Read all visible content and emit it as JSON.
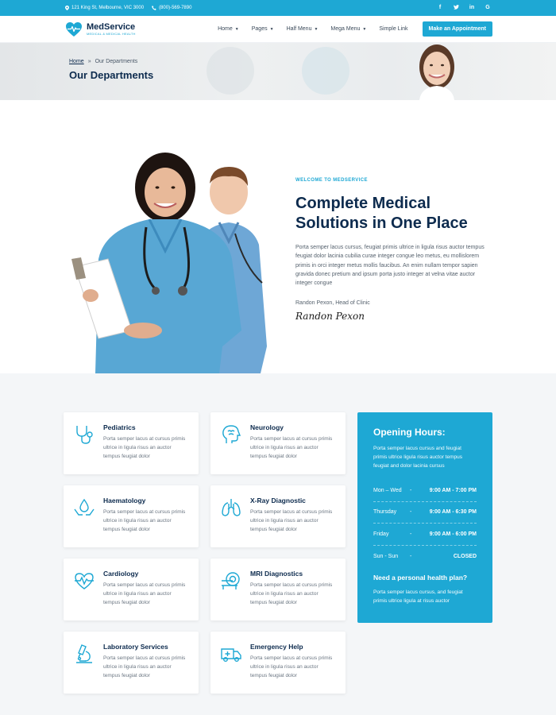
{
  "topbar": {
    "address": "121 King St, Melbourne, VIC 3000",
    "phone": "(800)-569-7890",
    "social": [
      "f",
      "t",
      "in",
      "G"
    ]
  },
  "brand": {
    "name": "MedService",
    "tagline": "MEDICAL & MEDICAL HEALTH"
  },
  "nav": {
    "items": [
      {
        "label": "Home",
        "has_dropdown": true
      },
      {
        "label": "Pages",
        "has_dropdown": true
      },
      {
        "label": "Half Menu",
        "has_dropdown": true
      },
      {
        "label": "Mega Menu",
        "has_dropdown": true
      },
      {
        "label": "Simple Link",
        "has_dropdown": false
      }
    ],
    "cta": "Make an Appointment"
  },
  "page_header": {
    "breadcrumb_home": "Home",
    "breadcrumb_sep": "»",
    "breadcrumb_current": "Our Departments",
    "title": "Our Departments"
  },
  "about": {
    "eyebrow": "WELCOME TO MEDSERVICE",
    "title": "Complete Medical Solutions in One Place",
    "body": "Porta semper lacus cursus, feugiat primis ultrice in ligula risus auctor tempus feugiat dolor lacinia cubilia curae integer congue leo metus, eu mollislorem primis in orci integer metus mollis faucibus. An enim nullam tempor sapien gravida donec pretium and ipsum porta justo integer at velna vitae auctor integer congue",
    "signer": "Randon Pexon, Head of Clinic",
    "signature": "Randon Pexon"
  },
  "departments": [
    {
      "name": "Pediatrics",
      "icon": "stethoscope-icon",
      "desc": "Porta semper lacus at cursus primis ultrice in ligula risus an auctor tempus feugiat dolor"
    },
    {
      "name": "Neurology",
      "icon": "head-brain-icon",
      "desc": "Porta semper lacus at cursus primis ultrice in ligula risus an auctor tempus feugiat dolor"
    },
    {
      "name": "Haematology",
      "icon": "blood-drop-hands-icon",
      "desc": "Porta semper lacus at cursus primis ultrice in ligula risus an auctor tempus feugiat dolor"
    },
    {
      "name": "X-Ray Diagnostic",
      "icon": "lungs-icon",
      "desc": "Porta semper lacus at cursus primis ultrice in ligula risus an auctor tempus feugiat dolor"
    },
    {
      "name": "Cardiology",
      "icon": "heart-pulse-icon",
      "desc": "Porta semper lacus at cursus primis ultrice in ligula risus an auctor tempus feugiat dolor"
    },
    {
      "name": "MRI Diagnostics",
      "icon": "mri-scanner-icon",
      "desc": "Porta semper lacus at cursus primis ultrice in ligula risus an auctor tempus feugiat dolor"
    },
    {
      "name": "Laboratory Services",
      "icon": "microscope-icon",
      "desc": "Porta semper lacus at cursus primis ultrice in ligula risus an auctor tempus feugiat dolor"
    },
    {
      "name": "Emergency Help",
      "icon": "ambulance-icon",
      "desc": "Porta semper lacus at cursus primis ultrice in ligula risus an auctor tempus feugiat dolor"
    }
  ],
  "hours": {
    "title": "Opening Hours:",
    "desc": "Porta semper lacus cursus and feugiat primis ultrice ligula risus auctor tempus feugiat and dolor lacinia cursus",
    "rows": [
      {
        "day": "Mon – Wed",
        "dash": "-",
        "time": "9:00 AM - 7:00 PM"
      },
      {
        "day": "Thursday",
        "dash": "-",
        "time": "9:00 AM - 6:30 PM"
      },
      {
        "day": "Friday",
        "dash": "-",
        "time": "9:00 AM - 6:00 PM"
      },
      {
        "day": "Sun - Sun",
        "dash": "-",
        "time": "CLOSED"
      }
    ],
    "plan_title": "Need a personal health plan?",
    "plan_desc": "Porta semper lacus cursus, and feugiat primis ultrice ligula at risus auctor"
  },
  "colors": {
    "accent": "#1ea8d4",
    "navy": "#0d2b4e",
    "section_bg": "#f4f6f8"
  }
}
